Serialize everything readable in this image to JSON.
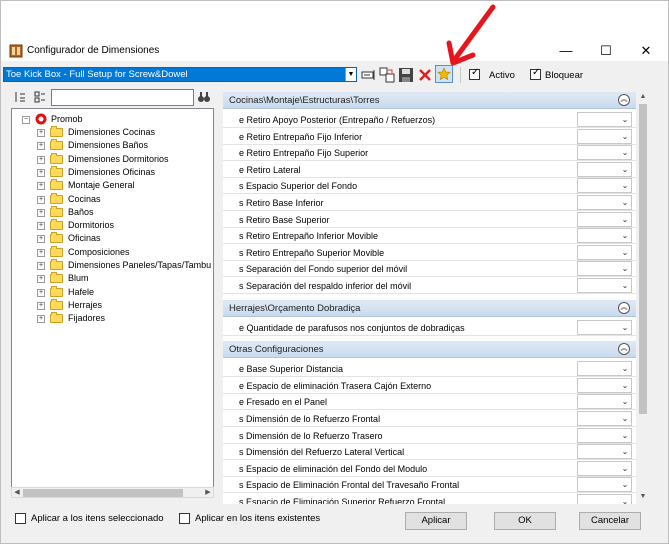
{
  "window": {
    "title": "Configurador de Dimensiones"
  },
  "titlebar_buttons": {
    "minimize": "—",
    "maximize": "☐",
    "close": "✕"
  },
  "toolbar": {
    "combo_value": "Toe Kick Box - Full Setup for Screw&Dowel",
    "activo_label": "Activo",
    "bloquear_label": "Bloquear",
    "activo_checked": true,
    "bloquear_checked": true
  },
  "tree": {
    "root": "Promob",
    "items": [
      "Dimensiones Cocinas",
      "Dimensiones Baños",
      "Dimensiones Dormitorios",
      "Dimensiones Oficinas",
      "Montaje General",
      "Cocinas",
      "Baños",
      "Dormitorios",
      "Oficinas",
      "Composiciones",
      "Dimensiones Paneles/Tapas/Tambu",
      "Blum",
      "Hafele",
      "Herrajes",
      "Fijadores"
    ]
  },
  "groups": [
    {
      "title": "Cocinas\\Montaje\\Estructuras\\Torres",
      "props": [
        "e Retiro Apoyo Posterior (Entrepaño / Refuerzos)",
        "e Retiro Entrepaño Fijo Inferior",
        "e Retiro Entrepaño Fijo Superior",
        "e Retiro Lateral",
        "s Espacio Superior del Fondo",
        "s Retiro Base Inferior",
        "s Retiro Base Superior",
        "s Retiro Entrepaño Inferior Movible",
        "s Retiro Entrepaño Superior Movible",
        "s Separación del Fondo superior del móvil",
        "s Separación del respaldo inferior del móvil"
      ]
    },
    {
      "title": "Herrajes\\Orçamento Dobradiça",
      "props": [
        "e Quantidade de parafusos nos conjuntos de dobradiças"
      ]
    },
    {
      "title": "Otras Configuraciones",
      "props": [
        "e Base Superior Distancia",
        "e Espacio de eliminación Trasera Cajón Externo",
        "e Fresado en el Panel",
        "s Dimensión de lo Refuerzo Frontal",
        "s Dimensión de lo Refuerzo Trasero",
        "s Dimensión del Refuerzo Lateral Vertical",
        "s Espacio de eliminación del Fondo del Modulo",
        "s Espacio de Eliminación Frontal del Travesaño Frontal",
        "s Espacio de Eliminación Superior Refuerzo Frontal"
      ]
    }
  ],
  "bottom": {
    "apply_selected_label": "Aplicar a los itens seleccionado",
    "apply_existing_label": "Aplicar en los itens existentes",
    "aplicar_button": "Aplicar",
    "ok_button": "OK",
    "cancel_button": "Cancelar"
  },
  "colors": {
    "combo_selected": "#0078d7",
    "group_header": "#c9daee",
    "annotation_arrow": "#e8141b"
  }
}
